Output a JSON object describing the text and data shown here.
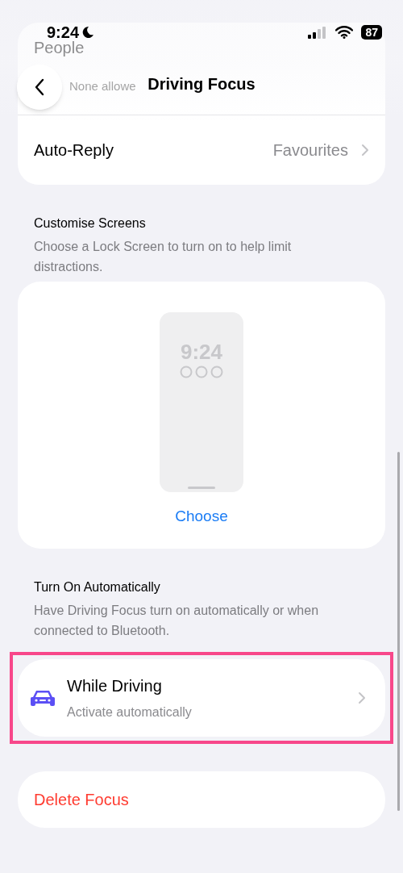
{
  "status_bar": {
    "time": "9:24",
    "battery": "87"
  },
  "nav": {
    "title": "Driving Focus"
  },
  "people_row": {
    "label": "People",
    "detail": "None allowe"
  },
  "auto_reply": {
    "label": "Auto-Reply",
    "value": "Favourites"
  },
  "customise": {
    "title": "Customise Screens",
    "description": "Choose a Lock Screen to turn on to help limit distractions.",
    "preview_time": "9:24",
    "action": "Choose"
  },
  "automation": {
    "title": "Turn On Automatically",
    "description": "Have Driving Focus turn on automatically or when connected to Bluetooth.",
    "items": [
      {
        "title": "While Driving",
        "subtitle": "Activate automatically",
        "highlighted": true
      }
    ]
  },
  "delete": {
    "label": "Delete Focus"
  }
}
